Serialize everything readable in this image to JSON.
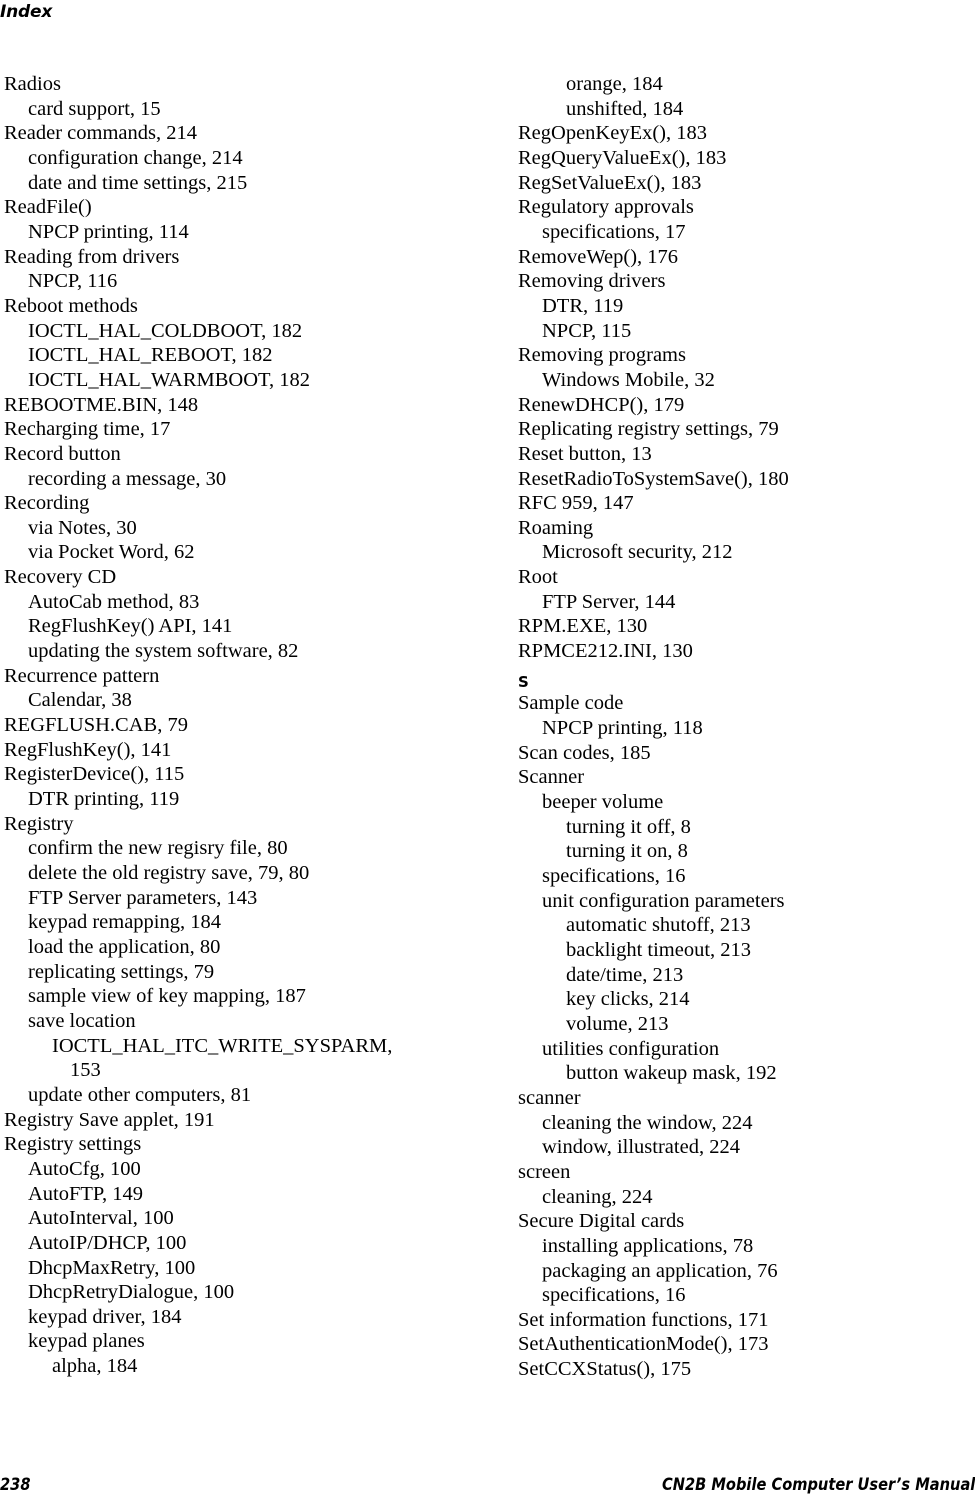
{
  "header": {
    "running_head": "Index"
  },
  "footer": {
    "page_number": "238",
    "manual_title": "CN2B Mobile Computer User’s Manual"
  },
  "index": {
    "left_column": [
      {
        "level": 1,
        "text": "Radios"
      },
      {
        "level": 2,
        "text": "card support, 15"
      },
      {
        "level": 1,
        "text": "Reader commands, 214"
      },
      {
        "level": 2,
        "text": "configuration change, 214"
      },
      {
        "level": 2,
        "text": "date and time settings, 215"
      },
      {
        "level": 1,
        "text": "ReadFile()"
      },
      {
        "level": 2,
        "text": "NPCP printing, 114"
      },
      {
        "level": 1,
        "text": "Reading from drivers"
      },
      {
        "level": 2,
        "text": "NPCP, 116"
      },
      {
        "level": 1,
        "text": "Reboot methods"
      },
      {
        "level": 2,
        "text": "IOCTL_HAL_COLDBOOT, 182"
      },
      {
        "level": 2,
        "text": "IOCTL_HAL_REBOOT, 182"
      },
      {
        "level": 2,
        "text": "IOCTL_HAL_WARMBOOT, 182"
      },
      {
        "level": 1,
        "text": "REBOOTME.BIN, 148"
      },
      {
        "level": 1,
        "text": "Recharging time, 17"
      },
      {
        "level": 1,
        "text": "Record button"
      },
      {
        "level": 2,
        "text": "recording a message, 30"
      },
      {
        "level": 1,
        "text": "Recording"
      },
      {
        "level": 2,
        "text": "via Notes, 30"
      },
      {
        "level": 2,
        "text": "via Pocket Word, 62"
      },
      {
        "level": 1,
        "text": "Recovery CD"
      },
      {
        "level": 2,
        "text": "AutoCab method, 83"
      },
      {
        "level": 2,
        "text": "RegFlushKey() API, 141"
      },
      {
        "level": 2,
        "text": "updating the system software, 82"
      },
      {
        "level": 1,
        "text": "Recurrence pattern"
      },
      {
        "level": 2,
        "text": "Calendar, 38"
      },
      {
        "level": 1,
        "text": "REGFLUSH.CAB, 79"
      },
      {
        "level": 1,
        "text": "RegFlushKey(), 141"
      },
      {
        "level": 1,
        "text": "RegisterDevice(), 115"
      },
      {
        "level": 2,
        "text": "DTR printing, 119"
      },
      {
        "level": 1,
        "text": "Registry"
      },
      {
        "level": 2,
        "text": "confirm the new regisry file, 80"
      },
      {
        "level": 2,
        "text": "delete the old registry save, 79, 80"
      },
      {
        "level": 2,
        "text": "FTP Server parameters, 143"
      },
      {
        "level": 2,
        "text": "keypad remapping, 184"
      },
      {
        "level": 2,
        "text": "load the application, 80"
      },
      {
        "level": 2,
        "text": "replicating settings, 79"
      },
      {
        "level": 2,
        "text": "sample view of key mapping, 187"
      },
      {
        "level": 2,
        "text": "save location"
      },
      {
        "level": 3,
        "text": "IOCTL_HAL_ITC_WRITE_SYSPARM,"
      },
      {
        "level": 4,
        "text": "153"
      },
      {
        "level": 2,
        "text": "update other computers, 81"
      },
      {
        "level": 1,
        "text": "Registry Save applet, 191"
      },
      {
        "level": 1,
        "text": "Registry settings"
      },
      {
        "level": 2,
        "text": "AutoCfg, 100"
      },
      {
        "level": 2,
        "text": "AutoFTP, 149"
      },
      {
        "level": 2,
        "text": "AutoInterval, 100"
      },
      {
        "level": 2,
        "text": "AutoIP/DHCP, 100"
      },
      {
        "level": 2,
        "text": "DhcpMaxRetry, 100"
      },
      {
        "level": 2,
        "text": "DhcpRetryDialogue, 100"
      },
      {
        "level": 2,
        "text": "keypad driver, 184"
      },
      {
        "level": 2,
        "text": "keypad planes"
      },
      {
        "level": 3,
        "text": "alpha, 184"
      }
    ],
    "right_column": [
      {
        "level": 3,
        "text": "orange, 184"
      },
      {
        "level": 3,
        "text": "unshifted, 184"
      },
      {
        "level": 1,
        "text": "RegOpenKeyEx(), 183"
      },
      {
        "level": 1,
        "text": "RegQueryValueEx(), 183"
      },
      {
        "level": 1,
        "text": "RegSetValueEx(), 183"
      },
      {
        "level": 1,
        "text": "Regulatory approvals"
      },
      {
        "level": 2,
        "text": "specifications, 17"
      },
      {
        "level": 1,
        "text": "RemoveWep(), 176"
      },
      {
        "level": 1,
        "text": "Removing drivers"
      },
      {
        "level": 2,
        "text": "DTR, 119"
      },
      {
        "level": 2,
        "text": "NPCP, 115"
      },
      {
        "level": 1,
        "text": "Removing programs"
      },
      {
        "level": 2,
        "text": "Windows Mobile, 32"
      },
      {
        "level": 1,
        "text": "RenewDHCP(), 179"
      },
      {
        "level": 1,
        "text": "Replicating registry settings, 79"
      },
      {
        "level": 1,
        "text": "Reset button, 13"
      },
      {
        "level": 1,
        "text": "ResetRadioToSystemSave(), 180"
      },
      {
        "level": 1,
        "text": "RFC 959, 147"
      },
      {
        "level": 1,
        "text": "Roaming"
      },
      {
        "level": 2,
        "text": "Microsoft security, 212"
      },
      {
        "level": 1,
        "text": "Root"
      },
      {
        "level": 2,
        "text": "FTP Server, 144"
      },
      {
        "level": 1,
        "text": "RPM.EXE, 130"
      },
      {
        "level": 1,
        "text": "RPMCE212.INI, 130"
      },
      {
        "level": 0,
        "text": "S"
      },
      {
        "level": 1,
        "text": "Sample code"
      },
      {
        "level": 2,
        "text": "NPCP printing, 118"
      },
      {
        "level": 1,
        "text": "Scan codes, 185"
      },
      {
        "level": 1,
        "text": "Scanner"
      },
      {
        "level": 2,
        "text": "beeper volume"
      },
      {
        "level": 3,
        "text": "turning it off, 8"
      },
      {
        "level": 3,
        "text": "turning it on, 8"
      },
      {
        "level": 2,
        "text": "specifications, 16"
      },
      {
        "level": 2,
        "text": "unit configuration parameters"
      },
      {
        "level": 3,
        "text": "automatic shutoff, 213"
      },
      {
        "level": 3,
        "text": "backlight timeout, 213"
      },
      {
        "level": 3,
        "text": "date/time, 213"
      },
      {
        "level": 3,
        "text": "key clicks, 214"
      },
      {
        "level": 3,
        "text": "volume, 213"
      },
      {
        "level": 2,
        "text": "utilities configuration"
      },
      {
        "level": 3,
        "text": "button wakeup mask, 192"
      },
      {
        "level": 1,
        "text": "scanner"
      },
      {
        "level": 2,
        "text": "cleaning the window, 224"
      },
      {
        "level": 2,
        "text": "window, illustrated, 224"
      },
      {
        "level": 1,
        "text": "screen"
      },
      {
        "level": 2,
        "text": "cleaning, 224"
      },
      {
        "level": 1,
        "text": "Secure Digital cards"
      },
      {
        "level": 2,
        "text": "installing applications, 78"
      },
      {
        "level": 2,
        "text": "packaging an application, 76"
      },
      {
        "level": 2,
        "text": "specifications, 16"
      },
      {
        "level": 1,
        "text": "Set information functions, 171"
      },
      {
        "level": 1,
        "text": "SetAuthenticationMode(), 173"
      },
      {
        "level": 1,
        "text": "SetCCXStatus(), 175"
      }
    ]
  }
}
